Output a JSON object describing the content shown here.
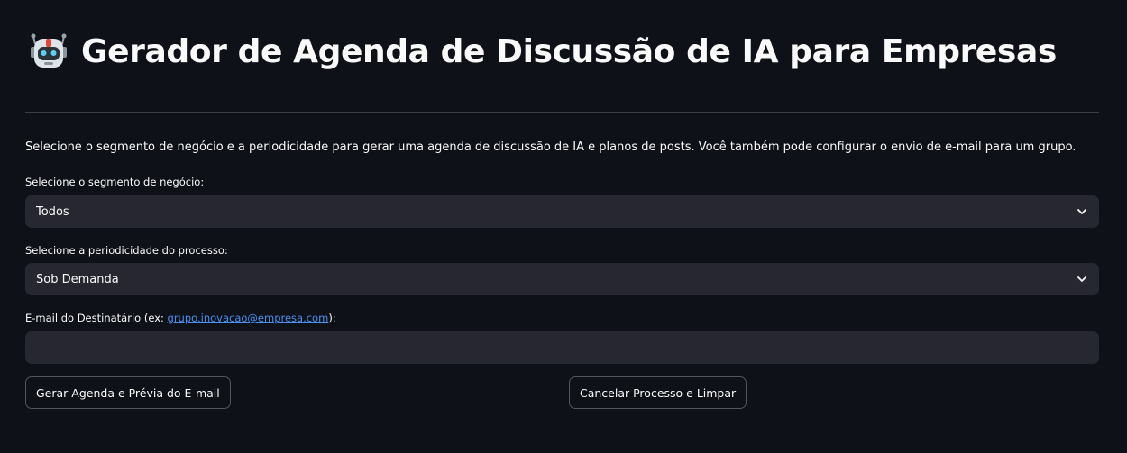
{
  "header": {
    "title_icon": "robot-icon",
    "title": "Gerador de Agenda de Discussão de IA para Empresas"
  },
  "intro": "Selecione o segmento de negócio e a periodicidade para gerar uma agenda de discussão de IA e planos de posts. Você também pode configurar o envio de e-mail para um grupo.",
  "segment": {
    "label": "Selecione o segmento de negócio:",
    "value": "Todos"
  },
  "frequency": {
    "label": "Selecione a periodicidade do processo:",
    "value": "Sob Demanda"
  },
  "email": {
    "label_prefix": "E-mail do Destinatário (ex: ",
    "label_link": "grupo.inovacao@empresa.com",
    "label_suffix": "):",
    "value": ""
  },
  "buttons": {
    "generate": "Gerar Agenda e Prévia do E-mail",
    "cancel": "Cancelar Processo e Limpar"
  },
  "colors": {
    "background": "#0e1117",
    "input_background": "#262730",
    "link": "#4b8ff0",
    "text": "#fafafa"
  }
}
